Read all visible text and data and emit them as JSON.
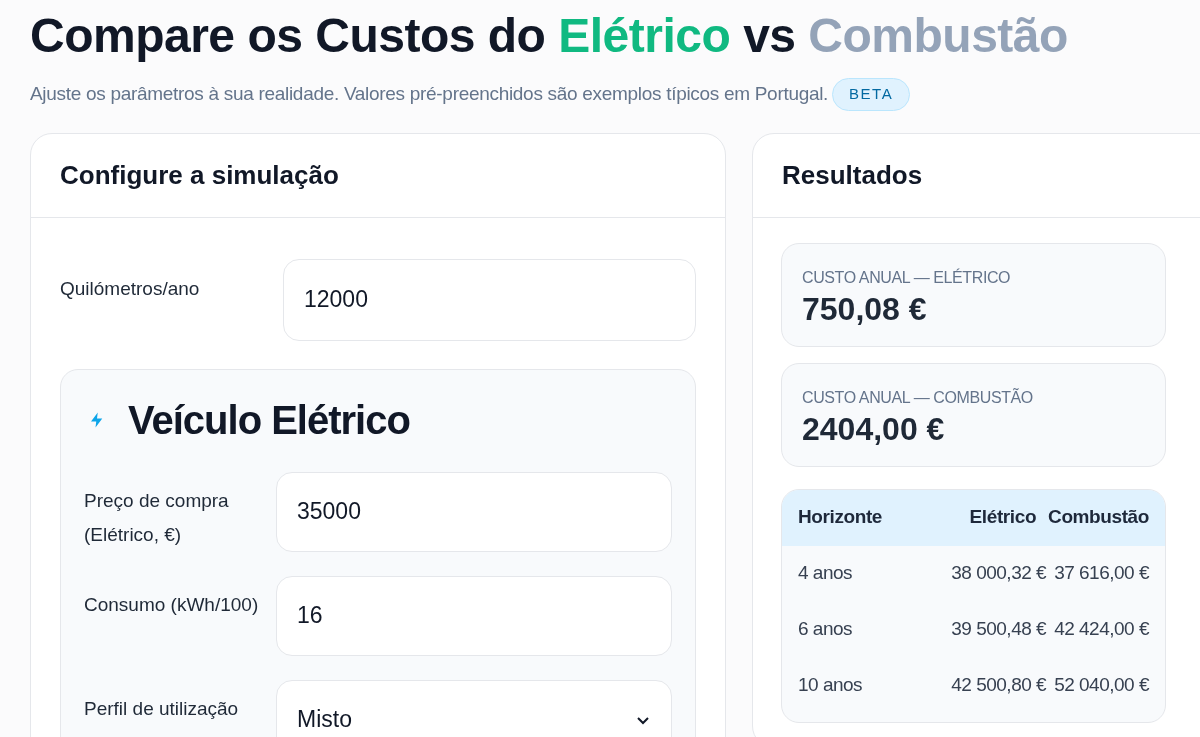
{
  "title": {
    "parts": [
      {
        "text": "Compare os Custos do ",
        "kind": "plain"
      },
      {
        "text": "Elétrico",
        "kind": "electric"
      },
      {
        "text": " vs ",
        "kind": "plain"
      },
      {
        "text": "Combustão",
        "kind": "combustion"
      }
    ]
  },
  "subtitle": "Ajuste os parâmetros à sua realidade. Valores pré-preenchidos são exemplos típicos em Portugal.",
  "badge": "BETA",
  "config": {
    "title": "Configure a simulação",
    "km": {
      "label": "Quilómetros/ano",
      "value": "12000"
    },
    "ev": {
      "title": "Veículo Elétrico",
      "fields": [
        {
          "kind": "number",
          "label": "Preço de compra (Elétrico, €)",
          "value": "35000"
        },
        {
          "kind": "number",
          "label": "Consumo (kWh/100)",
          "value": "16"
        },
        {
          "kind": "select",
          "label": "Perfil de utilização",
          "value": "Misto"
        }
      ]
    }
  },
  "results": {
    "title": "Resultados",
    "stats": [
      {
        "label": "CUSTO ANUAL — ELÉTRICO",
        "value": "750,08 €"
      },
      {
        "label": "CUSTO ANUAL — COMBUSTÃO",
        "value": "2404,00 €"
      }
    ],
    "table": {
      "columns": [
        "Horizonte",
        "Elétrico",
        "Combustão"
      ],
      "rows": [
        [
          "4 anos",
          "38 000,32 €",
          "37 616,00 €"
        ],
        [
          "6 anos",
          "39 500,48 €",
          "42 424,00 €"
        ],
        [
          "10 anos",
          "42 500,80 €",
          "52 040,00 €"
        ]
      ]
    }
  }
}
